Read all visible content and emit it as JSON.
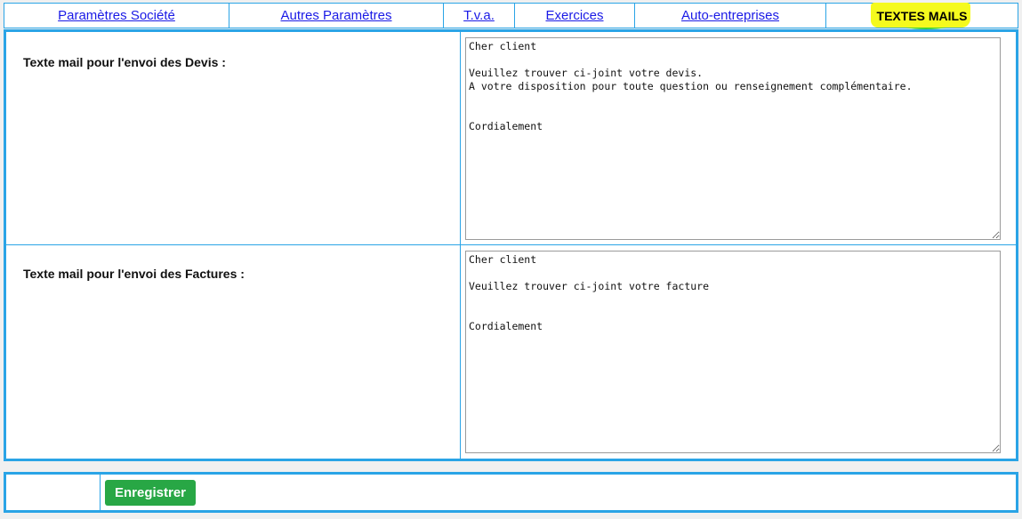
{
  "tabs": [
    {
      "label": "Paramètres Société",
      "active": false
    },
    {
      "label": "Autres Paramètres",
      "active": false
    },
    {
      "label": "T.v.a.",
      "active": false
    },
    {
      "label": "Exercices",
      "active": false
    },
    {
      "label": "Auto-entreprises",
      "active": false
    },
    {
      "label": "TEXTES MAILS",
      "active": true
    }
  ],
  "devis": {
    "label": "Texte mail pour l'envoi des Devis :",
    "text": "Cher client\n\nVeuillez trouver ci-joint votre devis.\nA votre disposition pour toute question ou renseignement complémentaire.\n\n\nCordialement"
  },
  "factures": {
    "label": "Texte mail pour l'envoi des Factures :",
    "text": "Cher client\n\nVeuillez trouver ci-joint votre facture\n\n\nCordialement"
  },
  "footer": {
    "save_label": "Enregistrer"
  },
  "colors": {
    "border": "#2aa4e6",
    "link": "#1a1ae6",
    "save_button": "#28a745",
    "active_highlight": "#f5fa1e"
  }
}
